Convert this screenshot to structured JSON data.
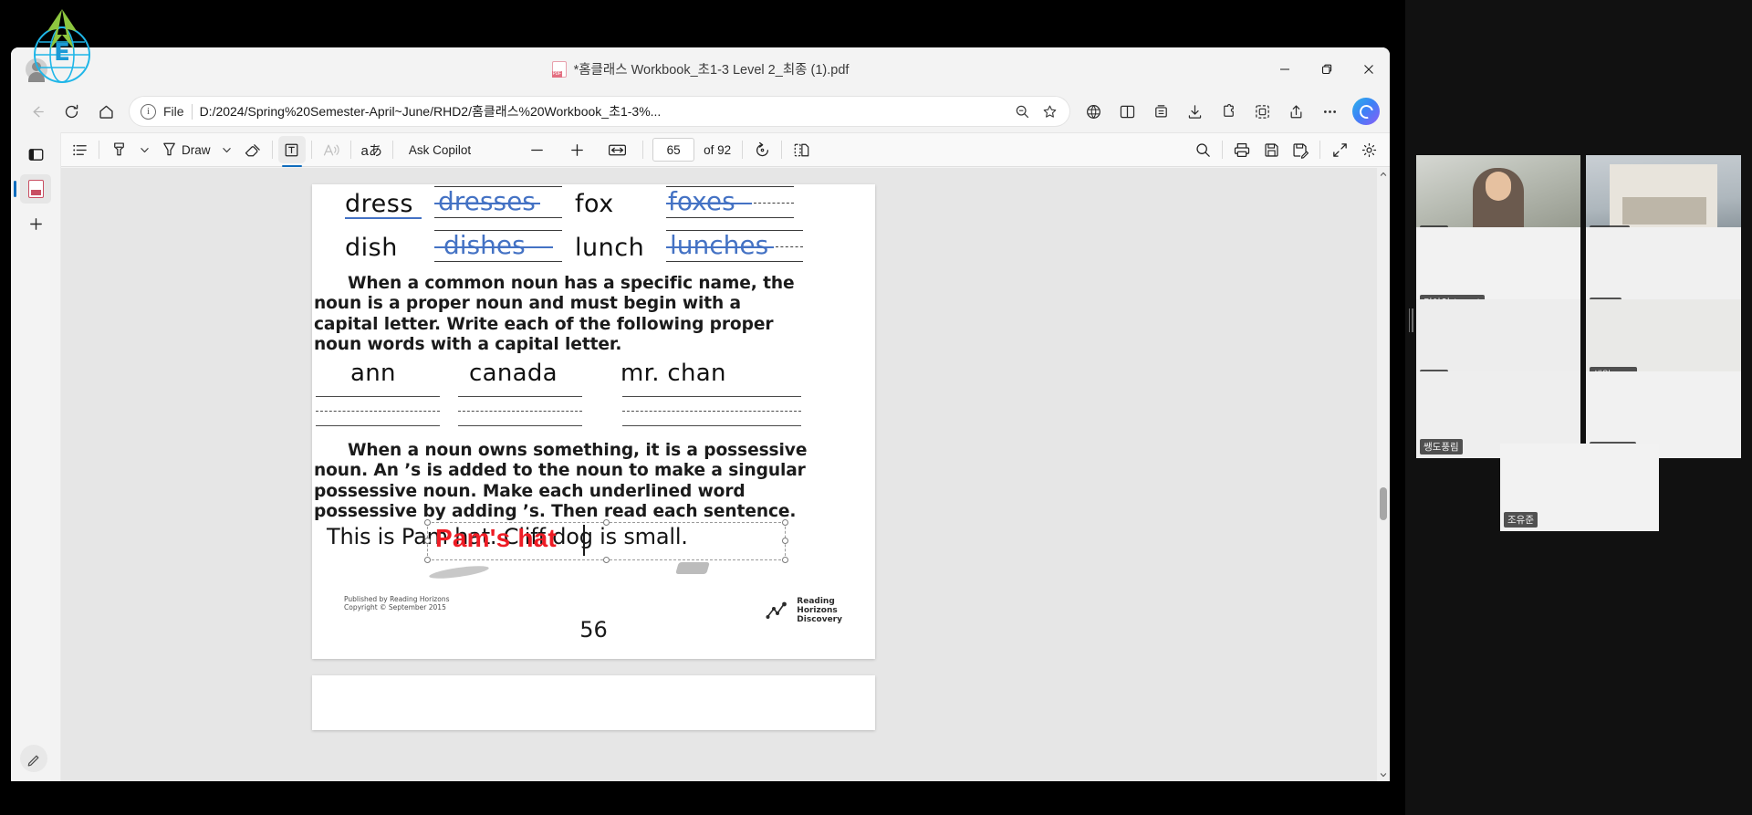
{
  "window": {
    "title": "*홈클래스 Workbook_초1-3 Level 2_최종 (1).pdf",
    "minimize_label": "Minimize",
    "restore_label": "Restore",
    "close_label": "Close"
  },
  "navbar": {
    "back_label": "Back",
    "refresh_label": "Refresh",
    "home_label": "Home",
    "file_label": "File",
    "url": "D:/2024/Spring%20Semester-April~June/RHD2/홈클래스%20Workbook_초1-3%...",
    "zoom_out_label": "Zoom out",
    "favorite_label": "Add to favorites",
    "copilot_label": "Copilot"
  },
  "browser_icons": {
    "split_screen": "split-screen-icon",
    "collections": "collections-icon",
    "browser_essentials": "browser-essentials-icon",
    "downloads": "downloads-icon",
    "extensions": "extensions-icon",
    "screenshot": "screenshot-icon",
    "share": "share-icon",
    "settings_more": "more-icon"
  },
  "pdf_toolbar": {
    "table_of_contents": "Table of contents",
    "highlight": "Highlight",
    "highlight_chevron": "Highlight options",
    "draw_label": "Draw",
    "draw_chevron": "Draw options",
    "erase": "Erase",
    "add_text": "Add text",
    "read_aloud": "Read aloud",
    "translate": "aあ",
    "ask_copilot": "Ask Copilot",
    "zoom_out": "Zoom out",
    "zoom_in": "Zoom in",
    "fit_to_width": "Fit to width",
    "page_current": "65",
    "page_of": "of 92",
    "rotate": "Rotate",
    "page_view": "Page view",
    "find": "Find",
    "print": "Print",
    "save": "Save",
    "save_as": "Save as",
    "full_screen": "Full screen",
    "settings": "Settings"
  },
  "left_rail": {
    "items": [
      {
        "name": "tabs-pane",
        "label": "Tab actions"
      },
      {
        "name": "pdf-file",
        "label": "PDF document"
      },
      {
        "name": "add-tab",
        "label": "New tab"
      }
    ],
    "bottom": {
      "name": "edit-pen",
      "label": "Editor"
    }
  },
  "worksheet": {
    "plural_rows": [
      {
        "word": "dress",
        "answer": "dresses"
      },
      {
        "word": "fox",
        "answer": "foxes"
      },
      {
        "word": "dish",
        "answer": "dishes"
      },
      {
        "word": "lunch",
        "answer": "lunches"
      }
    ],
    "para1": "When a common noun has a specific name, the noun is a proper noun and must begin with a capital letter. Write each of the following proper noun words with a capital letter.",
    "proper_nouns": [
      "ann",
      "canada",
      "mr. chan"
    ],
    "para2": "When a noun owns something, it is a possessive noun. An ’s is added to the noun to make a singular possessive noun. Make each underlined word possessive by adding ’s. Then read each sentence.",
    "sentence": "This is Pam hat. Cliff dog is small.",
    "annotation_text": "Pam's hat",
    "annotation_color": "#ee1c25",
    "page_number": "56",
    "footer_line1": "Published by Reading Horizons",
    "footer_line2": "Copyright © September 2015",
    "logo_line1": "Reading",
    "logo_line2": "Horizons",
    "logo_line3": "Discovery"
  },
  "video_panel": {
    "participants": [
      {
        "name": "Mary",
        "active": true
      },
      {
        "name": "YGLEC",
        "active": false
      },
      {
        "name": "민아인 (Irene)",
        "active": false
      },
      {
        "name": "Chole",
        "active": false
      },
      {
        "name": "suho",
        "active": false
      },
      {
        "name": "채웡Wren",
        "active": false
      },
      {
        "name": "쌩도풍림",
        "active": false
      },
      {
        "name": "(Matthew",
        "active": false
      },
      {
        "name": "조유준",
        "active": false
      }
    ]
  },
  "colors": {
    "accent": "#0f6cbd",
    "annotation_red": "#ee1c25",
    "ink_blue": "#4472c4",
    "active_speaker": "#c8f24a"
  }
}
